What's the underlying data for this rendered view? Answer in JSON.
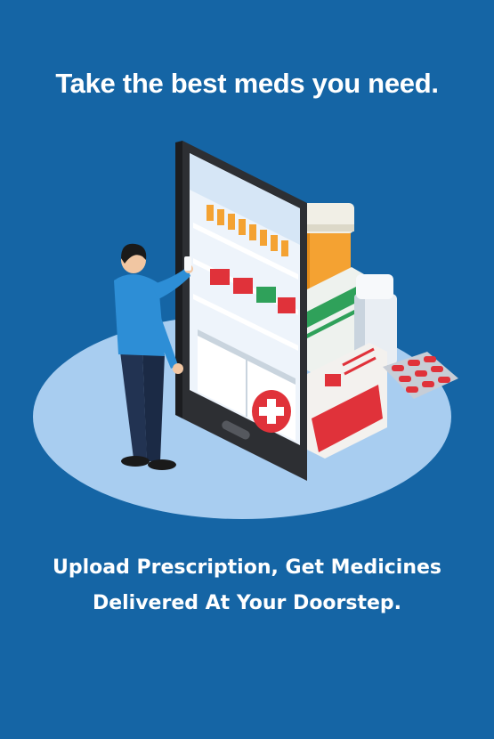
{
  "header": {
    "title": "Take the best meds you need."
  },
  "illustration": {
    "icon": "pharmacy-phone-illustration",
    "colors": {
      "background": "#1565a5",
      "platform": "#a8cdf0",
      "phone": "#2d2f33",
      "cross": "#e0323a",
      "bottle_orange": "#f4a232"
    }
  },
  "tagline": {
    "line1": "Upload Prescription, Get Medicines",
    "line2": "Delivered At Your Doorstep."
  }
}
